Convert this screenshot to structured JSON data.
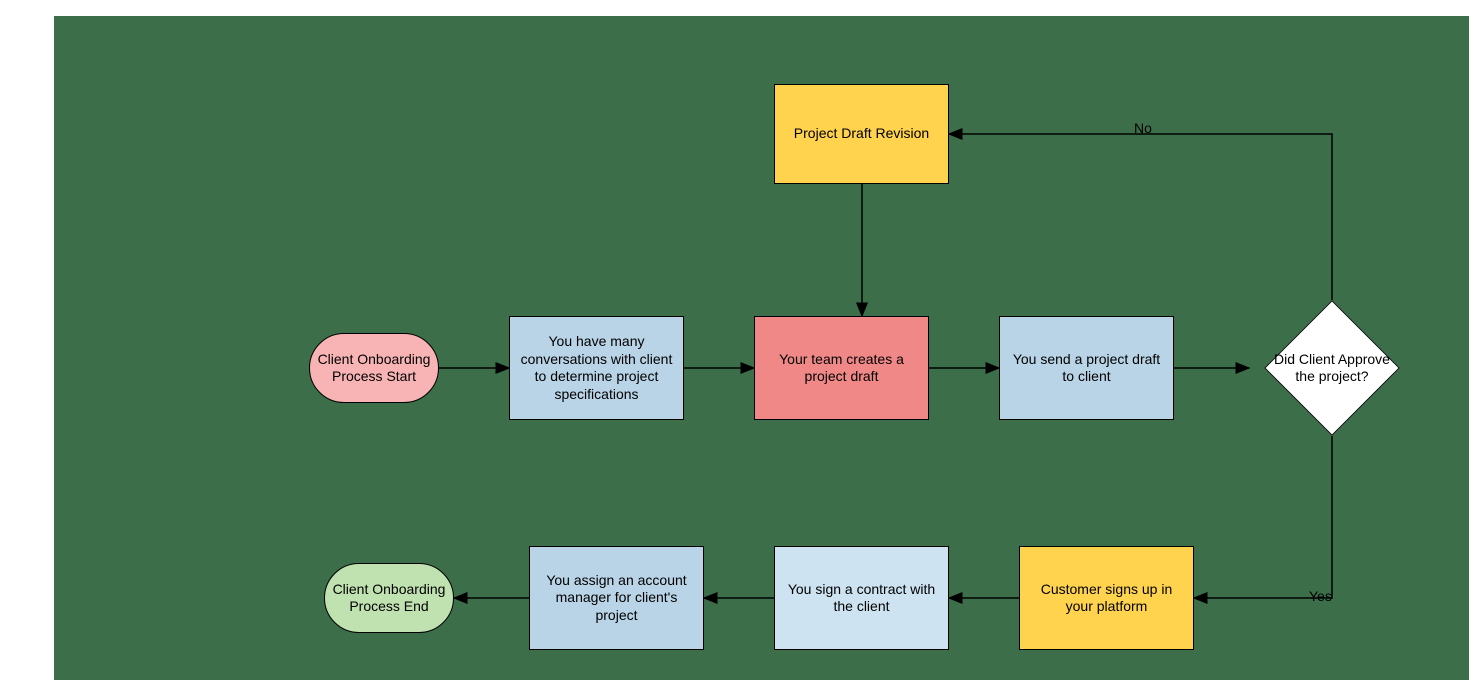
{
  "chart_data": {
    "type": "flowchart",
    "nodes": [
      {
        "id": "start",
        "shape": "terminator",
        "text": "Client Onboarding Process Start",
        "fill": "#f8b4b4"
      },
      {
        "id": "conversations",
        "shape": "process",
        "text": "You have many conversations with client to determine project specifications",
        "fill": "#b9d4e7"
      },
      {
        "id": "create_draft",
        "shape": "process",
        "text": "Your team creates a project draft",
        "fill": "#f08888"
      },
      {
        "id": "send_draft",
        "shape": "process",
        "text": "You send a project draft to client",
        "fill": "#b9d4e7"
      },
      {
        "id": "decision",
        "shape": "decision",
        "text": "Did Client Approve the project?",
        "fill": "#ffffff"
      },
      {
        "id": "revision",
        "shape": "process",
        "text": "Project Draft Revision",
        "fill": "#ffd34d"
      },
      {
        "id": "signup",
        "shape": "process",
        "text": "Customer signs up in your platform",
        "fill": "#ffd34d"
      },
      {
        "id": "contract",
        "shape": "process",
        "text": "You sign a contract with the client",
        "fill": "#cde3f1"
      },
      {
        "id": "assign_mgr",
        "shape": "process",
        "text": "You assign an account manager for client's project",
        "fill": "#b9d4e7"
      },
      {
        "id": "end",
        "shape": "terminator",
        "text": "Client Onboarding Process End",
        "fill": "#c0e1b0"
      }
    ],
    "edges": [
      {
        "from": "start",
        "to": "conversations"
      },
      {
        "from": "conversations",
        "to": "create_draft"
      },
      {
        "from": "create_draft",
        "to": "send_draft"
      },
      {
        "from": "send_draft",
        "to": "decision"
      },
      {
        "from": "decision",
        "to": "revision",
        "label": "No"
      },
      {
        "from": "revision",
        "to": "create_draft"
      },
      {
        "from": "decision",
        "to": "signup",
        "label": "Yes"
      },
      {
        "from": "signup",
        "to": "contract"
      },
      {
        "from": "contract",
        "to": "assign_mgr"
      },
      {
        "from": "assign_mgr",
        "to": "end"
      }
    ]
  },
  "labels": {
    "start": "Client Onboarding Process Start",
    "conversations": "You have many conversations with client to determine project specifications",
    "create_draft": "Your team creates a project draft",
    "send_draft": "You send a project draft to client",
    "decision": "Did Client Approve the project?",
    "revision": "Project Draft Revision",
    "signup": "Customer signs up in your platform",
    "contract": "You sign a contract with the client",
    "assign_mgr": "You assign an account manager for client's project",
    "end": "Client Onboarding Process End",
    "no": "No",
    "yes": "Yes"
  },
  "colors": {
    "canvas": "#3b6e49",
    "pink": "#f8b4b4",
    "green": "#c0e1b0",
    "blue": "#b9d4e7",
    "lightblue": "#cde3f1",
    "yellow": "#ffd34d",
    "red": "#f08888",
    "white": "#ffffff"
  }
}
